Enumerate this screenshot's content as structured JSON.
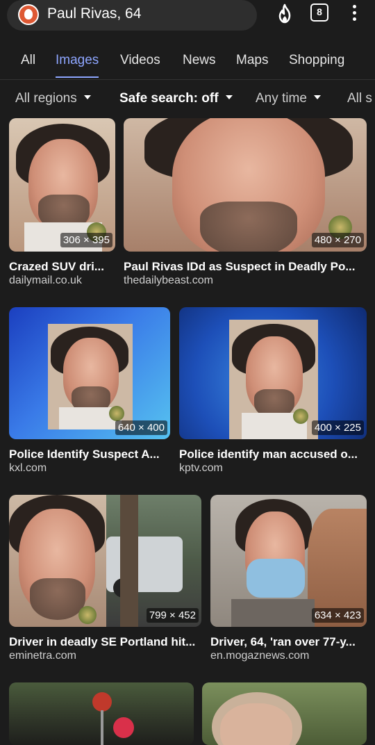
{
  "search": {
    "query": "Paul Rivas, 64",
    "tab_count": "8"
  },
  "nav": {
    "tabs": [
      {
        "label": "All"
      },
      {
        "label": "Images"
      },
      {
        "label": "Videos"
      },
      {
        "label": "News"
      },
      {
        "label": "Maps"
      },
      {
        "label": "Shopping"
      }
    ]
  },
  "filters": {
    "region": "All regions",
    "safe_search": "Safe search: off",
    "time": "Any time",
    "size": "All s"
  },
  "results": [
    {
      "title": "Crazed SUV dri...",
      "source": "dailymail.co.uk",
      "dims": "306 × 395"
    },
    {
      "title": "Paul Rivas IDd as Suspect in Deadly Po...",
      "source": "thedailybeast.com",
      "dims": "480 × 270"
    },
    {
      "title": "Police Identify Suspect A...",
      "source": "kxl.com",
      "dims": "640 × 400"
    },
    {
      "title": "Police identify man accused o...",
      "source": "kptv.com",
      "dims": "400 × 225"
    },
    {
      "title": "Driver in deadly SE Portland hit...",
      "source": "eminetra.com",
      "dims": "799 × 452"
    },
    {
      "title": "Driver, 64, 'ran over 77-y...",
      "source": "en.mogaznews.com",
      "dims": "634 × 423"
    }
  ],
  "icons": {
    "logo": "duckduckgo-logo",
    "fire": "fire-icon",
    "tabs": "tabs-counter-icon",
    "menu": "more-vert-icon"
  },
  "colors": {
    "accent": "#8ea6ff",
    "background": "#1c1c1c"
  }
}
